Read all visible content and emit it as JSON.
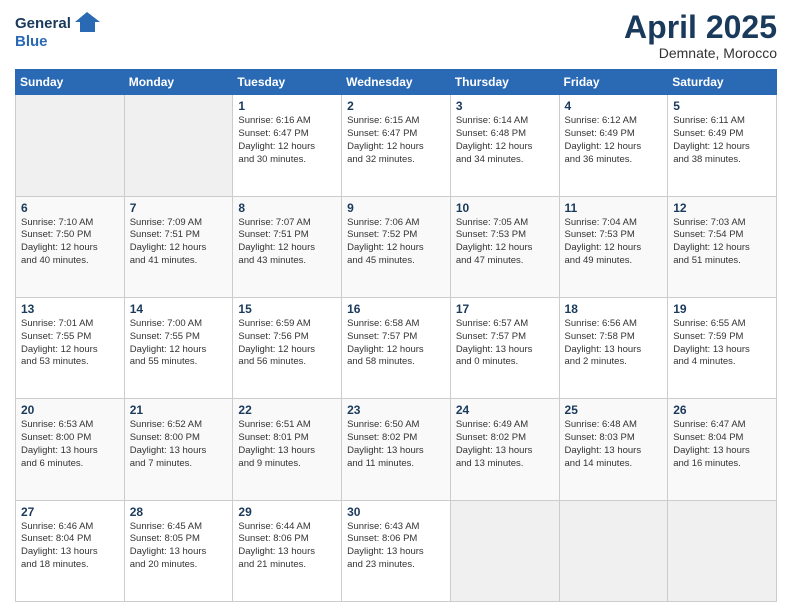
{
  "logo": {
    "line1": "General",
    "line2": "Blue"
  },
  "title": "April 2025",
  "subtitle": "Demnate, Morocco",
  "weekdays": [
    "Sunday",
    "Monday",
    "Tuesday",
    "Wednesday",
    "Thursday",
    "Friday",
    "Saturday"
  ],
  "weeks": [
    [
      {
        "day": "",
        "info": ""
      },
      {
        "day": "",
        "info": ""
      },
      {
        "day": "1",
        "info": "Sunrise: 6:16 AM\nSunset: 6:47 PM\nDaylight: 12 hours\nand 30 minutes."
      },
      {
        "day": "2",
        "info": "Sunrise: 6:15 AM\nSunset: 6:47 PM\nDaylight: 12 hours\nand 32 minutes."
      },
      {
        "day": "3",
        "info": "Sunrise: 6:14 AM\nSunset: 6:48 PM\nDaylight: 12 hours\nand 34 minutes."
      },
      {
        "day": "4",
        "info": "Sunrise: 6:12 AM\nSunset: 6:49 PM\nDaylight: 12 hours\nand 36 minutes."
      },
      {
        "day": "5",
        "info": "Sunrise: 6:11 AM\nSunset: 6:49 PM\nDaylight: 12 hours\nand 38 minutes."
      }
    ],
    [
      {
        "day": "6",
        "info": "Sunrise: 7:10 AM\nSunset: 7:50 PM\nDaylight: 12 hours\nand 40 minutes."
      },
      {
        "day": "7",
        "info": "Sunrise: 7:09 AM\nSunset: 7:51 PM\nDaylight: 12 hours\nand 41 minutes."
      },
      {
        "day": "8",
        "info": "Sunrise: 7:07 AM\nSunset: 7:51 PM\nDaylight: 12 hours\nand 43 minutes."
      },
      {
        "day": "9",
        "info": "Sunrise: 7:06 AM\nSunset: 7:52 PM\nDaylight: 12 hours\nand 45 minutes."
      },
      {
        "day": "10",
        "info": "Sunrise: 7:05 AM\nSunset: 7:53 PM\nDaylight: 12 hours\nand 47 minutes."
      },
      {
        "day": "11",
        "info": "Sunrise: 7:04 AM\nSunset: 7:53 PM\nDaylight: 12 hours\nand 49 minutes."
      },
      {
        "day": "12",
        "info": "Sunrise: 7:03 AM\nSunset: 7:54 PM\nDaylight: 12 hours\nand 51 minutes."
      }
    ],
    [
      {
        "day": "13",
        "info": "Sunrise: 7:01 AM\nSunset: 7:55 PM\nDaylight: 12 hours\nand 53 minutes."
      },
      {
        "day": "14",
        "info": "Sunrise: 7:00 AM\nSunset: 7:55 PM\nDaylight: 12 hours\nand 55 minutes."
      },
      {
        "day": "15",
        "info": "Sunrise: 6:59 AM\nSunset: 7:56 PM\nDaylight: 12 hours\nand 56 minutes."
      },
      {
        "day": "16",
        "info": "Sunrise: 6:58 AM\nSunset: 7:57 PM\nDaylight: 12 hours\nand 58 minutes."
      },
      {
        "day": "17",
        "info": "Sunrise: 6:57 AM\nSunset: 7:57 PM\nDaylight: 13 hours\nand 0 minutes."
      },
      {
        "day": "18",
        "info": "Sunrise: 6:56 AM\nSunset: 7:58 PM\nDaylight: 13 hours\nand 2 minutes."
      },
      {
        "day": "19",
        "info": "Sunrise: 6:55 AM\nSunset: 7:59 PM\nDaylight: 13 hours\nand 4 minutes."
      }
    ],
    [
      {
        "day": "20",
        "info": "Sunrise: 6:53 AM\nSunset: 8:00 PM\nDaylight: 13 hours\nand 6 minutes."
      },
      {
        "day": "21",
        "info": "Sunrise: 6:52 AM\nSunset: 8:00 PM\nDaylight: 13 hours\nand 7 minutes."
      },
      {
        "day": "22",
        "info": "Sunrise: 6:51 AM\nSunset: 8:01 PM\nDaylight: 13 hours\nand 9 minutes."
      },
      {
        "day": "23",
        "info": "Sunrise: 6:50 AM\nSunset: 8:02 PM\nDaylight: 13 hours\nand 11 minutes."
      },
      {
        "day": "24",
        "info": "Sunrise: 6:49 AM\nSunset: 8:02 PM\nDaylight: 13 hours\nand 13 minutes."
      },
      {
        "day": "25",
        "info": "Sunrise: 6:48 AM\nSunset: 8:03 PM\nDaylight: 13 hours\nand 14 minutes."
      },
      {
        "day": "26",
        "info": "Sunrise: 6:47 AM\nSunset: 8:04 PM\nDaylight: 13 hours\nand 16 minutes."
      }
    ],
    [
      {
        "day": "27",
        "info": "Sunrise: 6:46 AM\nSunset: 8:04 PM\nDaylight: 13 hours\nand 18 minutes."
      },
      {
        "day": "28",
        "info": "Sunrise: 6:45 AM\nSunset: 8:05 PM\nDaylight: 13 hours\nand 20 minutes."
      },
      {
        "day": "29",
        "info": "Sunrise: 6:44 AM\nSunset: 8:06 PM\nDaylight: 13 hours\nand 21 minutes."
      },
      {
        "day": "30",
        "info": "Sunrise: 6:43 AM\nSunset: 8:06 PM\nDaylight: 13 hours\nand 23 minutes."
      },
      {
        "day": "",
        "info": ""
      },
      {
        "day": "",
        "info": ""
      },
      {
        "day": "",
        "info": ""
      }
    ]
  ]
}
